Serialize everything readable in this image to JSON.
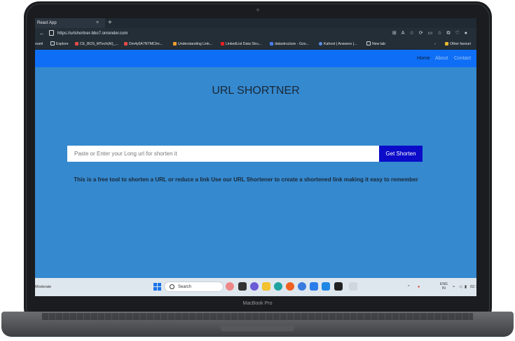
{
  "browser": {
    "tab_title": "React App",
    "tab_close": "×",
    "new_tab": "+",
    "url": "https://urlshortner-bbo7.onrender.com",
    "bookmarks": [
      {
        "label": "ouml",
        "color": "#232e37"
      },
      {
        "label": "Explore",
        "color": "#cfd6dc"
      },
      {
        "label": "CE_BOS_MTech(AI)_...",
        "color": "#e34b4b"
      },
      {
        "label": "Dm4y0A7NTMCIm...",
        "color": "#e34b4b"
      },
      {
        "label": "Understanding Link...",
        "color": "#f0a030"
      },
      {
        "label": "LinkedList Data Stru...",
        "color": "#e82020"
      },
      {
        "label": "datastructure - Goo...",
        "color": "#4a7cf0"
      },
      {
        "label": "Kahoot | Answers |...",
        "color": "#5a8de8"
      },
      {
        "label": "New tab",
        "color": "#cfd6dc"
      }
    ],
    "bookmarks_other": "Other favouri"
  },
  "nav": {
    "home": "Home",
    "about": "About",
    "contact": "Contact"
  },
  "page": {
    "title": "URL SHORTNER",
    "input_placeholder": "Paste or Enter your Long url for shorten it",
    "button_label": "Get Shorten",
    "description": "This is a free tool to shorten a URL or reduce a link Use our URL Shortener to create a shortened link making it easy to remember"
  },
  "taskbar": {
    "weather": "Moderate",
    "search_label": "Search",
    "language": "ENG",
    "region": "IN",
    "time": "02:1"
  },
  "device": {
    "brand": "MacBook Pro"
  },
  "colors": {
    "page_bg": "#3589cf",
    "navbar": "#0e6ff6",
    "button": "#0b0bc9"
  }
}
